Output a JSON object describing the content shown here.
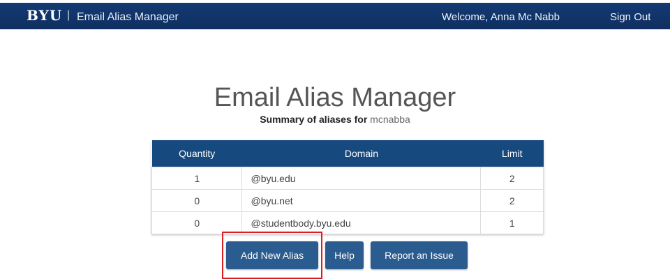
{
  "header": {
    "brand": "BYU",
    "separator": "|",
    "app_name": "Email Alias Manager",
    "welcome": "Welcome, Anna Mc Nabb",
    "signout_label": "Sign Out"
  },
  "main": {
    "title": "Email Alias Manager",
    "summary_label": "Summary of aliases for",
    "username": "mcnabba"
  },
  "table": {
    "headers": [
      "Quantity",
      "Domain",
      "Limit"
    ],
    "rows": [
      {
        "quantity": "1",
        "domain": "@byu.edu",
        "limit": "2"
      },
      {
        "quantity": "0",
        "domain": "@byu.net",
        "limit": "2"
      },
      {
        "quantity": "0",
        "domain": "@studentbody.byu.edu",
        "limit": "1"
      }
    ]
  },
  "buttons": {
    "add_label": "Add New Alias",
    "help_label": "Help",
    "report_label": "Report an Issue"
  },
  "colors": {
    "header_bg": "#133a73",
    "table_header_bg": "#16497e",
    "button_bg": "#2b5c8f",
    "highlight": "#d81f26"
  }
}
